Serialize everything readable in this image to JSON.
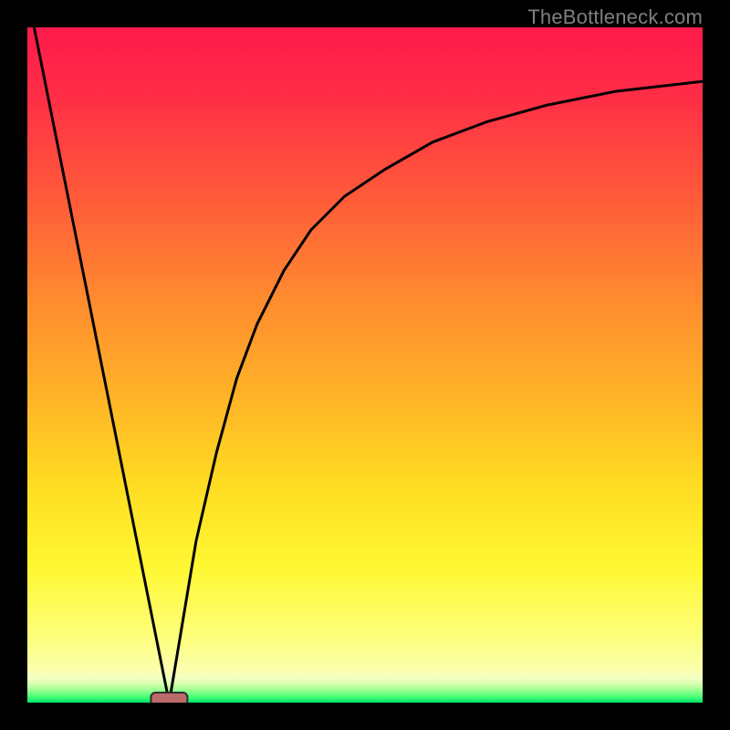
{
  "watermark": "TheBottleneck.com",
  "colors": {
    "frame": "#000000",
    "watermark": "#7f7f7f",
    "curve": "#000000",
    "marker_fill": "#bd6a6b",
    "marker_stroke": "#2e2e2e",
    "gradient_stops": [
      {
        "offset": 0.0,
        "color": "#ff1a4b"
      },
      {
        "offset": 0.1,
        "color": "#ff2d46"
      },
      {
        "offset": 0.25,
        "color": "#ff5a3a"
      },
      {
        "offset": 0.4,
        "color": "#ff8a2f"
      },
      {
        "offset": 0.55,
        "color": "#ffb427"
      },
      {
        "offset": 0.68,
        "color": "#ffdd22"
      },
      {
        "offset": 0.8,
        "color": "#fff733"
      },
      {
        "offset": 0.9,
        "color": "#fdff7a"
      },
      {
        "offset": 0.953,
        "color": "#fcffaf"
      },
      {
        "offset": 0.963,
        "color": "#f4ffc4"
      },
      {
        "offset": 0.972,
        "color": "#d8ffb0"
      },
      {
        "offset": 0.982,
        "color": "#98ff8f"
      },
      {
        "offset": 0.991,
        "color": "#4dff76"
      },
      {
        "offset": 1.0,
        "color": "#00e36a"
      }
    ]
  },
  "chart_data": {
    "type": "line",
    "title": "",
    "xlabel": "",
    "ylabel": "",
    "xlim": [
      0,
      100
    ],
    "ylim": [
      0,
      100
    ],
    "grid": false,
    "legend": false,
    "series": [
      {
        "name": "left-branch",
        "x": [
          1,
          4,
          7,
          10,
          13,
          15,
          17,
          19,
          21
        ],
        "values": [
          100,
          85,
          70,
          55,
          40,
          30,
          20,
          10,
          0
        ]
      },
      {
        "name": "right-branch",
        "x": [
          21,
          23,
          25,
          28,
          31,
          34,
          38,
          42,
          47,
          53,
          60,
          68,
          77,
          87,
          100
        ],
        "values": [
          0,
          12,
          24,
          37,
          48,
          56,
          64,
          70,
          75,
          79,
          83,
          86,
          88.5,
          90.5,
          92
        ]
      }
    ],
    "annotations": [
      {
        "name": "minimum-marker",
        "x": 21,
        "y": 0,
        "shape": "rounded-rect"
      }
    ]
  }
}
